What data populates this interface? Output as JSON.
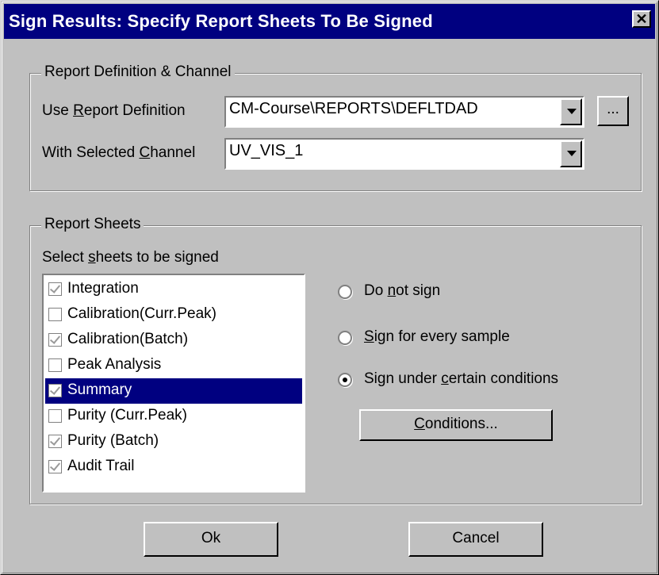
{
  "window": {
    "title": "Sign Results: Specify Report Sheets To Be Signed",
    "close_glyph": "✕"
  },
  "report_def_group": {
    "legend": "Report Definition & Channel",
    "use_report_label_pre": "Use ",
    "use_report_label_u": "R",
    "use_report_label_post": "eport Definition",
    "report_value": "CM-Course\\REPORTS\\DEFLTDAD",
    "browse_label": "...",
    "channel_label_pre": "With Selected ",
    "channel_label_u": "C",
    "channel_label_post": "hannel",
    "channel_value": "UV_VIS_1"
  },
  "sheets_group": {
    "legend": "Report Sheets",
    "select_label_pre": "Select ",
    "select_label_u": "s",
    "select_label_post": "heets to be signed",
    "items": [
      {
        "label": "Integration",
        "checked": true
      },
      {
        "label": "Calibration(Curr.Peak)",
        "checked": false
      },
      {
        "label": "Calibration(Batch)",
        "checked": true
      },
      {
        "label": "Peak Analysis",
        "checked": false
      },
      {
        "label": "Summary",
        "checked": true,
        "selected": true
      },
      {
        "label": "Purity (Curr.Peak)",
        "checked": false
      },
      {
        "label": "Purity (Batch)",
        "checked": true
      },
      {
        "label": "Audit Trail",
        "checked": true
      }
    ],
    "options": [
      {
        "pre": "Do ",
        "u": "n",
        "post": "ot sign",
        "selected": false
      },
      {
        "pre": "",
        "u": "S",
        "post": "ign for every sample",
        "selected": false
      },
      {
        "pre": "Sign under ",
        "u": "c",
        "post": "ertain conditions",
        "selected": true
      }
    ],
    "conditions_pre": "",
    "conditions_u": "C",
    "conditions_post": "onditions..."
  },
  "footer": {
    "ok_label": "Ok",
    "cancel_label": "Cancel"
  }
}
